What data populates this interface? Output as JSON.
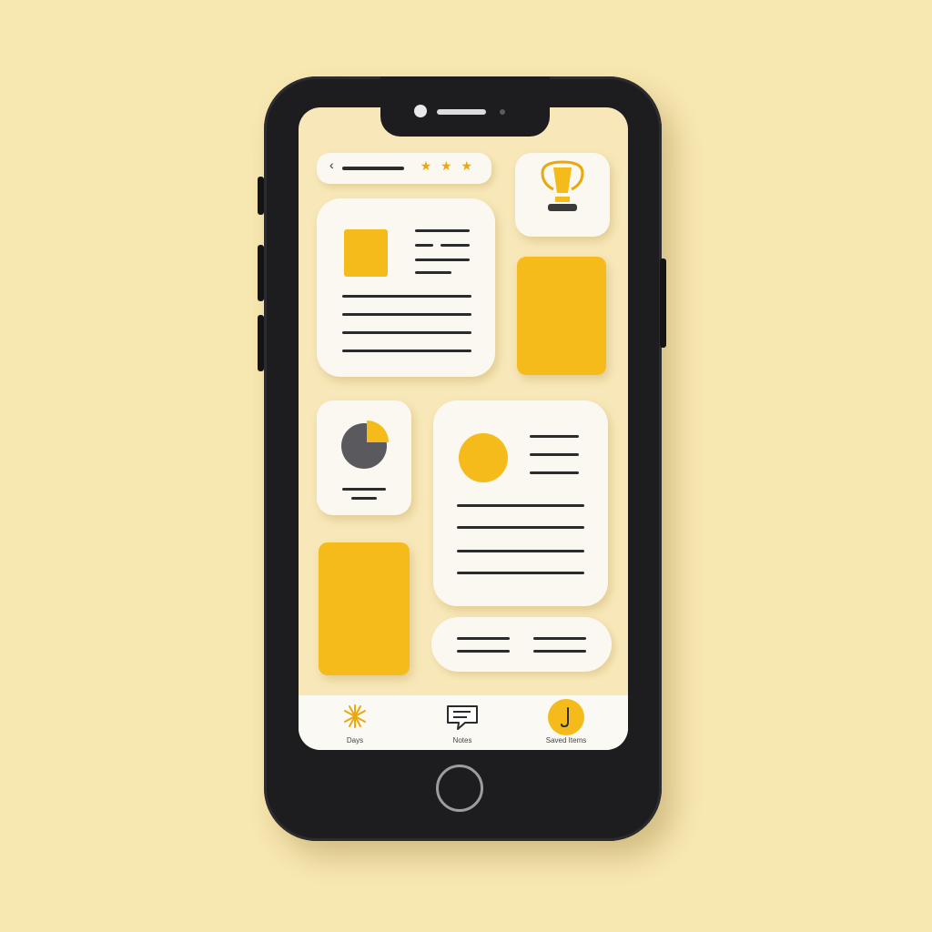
{
  "header": {
    "back_icon": "chevron-left-icon",
    "rating_stars": "★ ★ ★"
  },
  "trophy_card": {
    "icon": "trophy-icon"
  },
  "chart_card": {
    "icon": "pie-chart-icon"
  },
  "colors": {
    "accent": "#f4bb1b",
    "background": "#f7e7b0",
    "card": "#faf8f1",
    "phone": "#1d1d20"
  },
  "tabbar": {
    "items": [
      {
        "label": "Days",
        "icon": "asterisk-icon"
      },
      {
        "label": "Notes",
        "icon": "message-icon"
      },
      {
        "label": "Saved Items",
        "icon": "music-note-icon"
      }
    ]
  }
}
